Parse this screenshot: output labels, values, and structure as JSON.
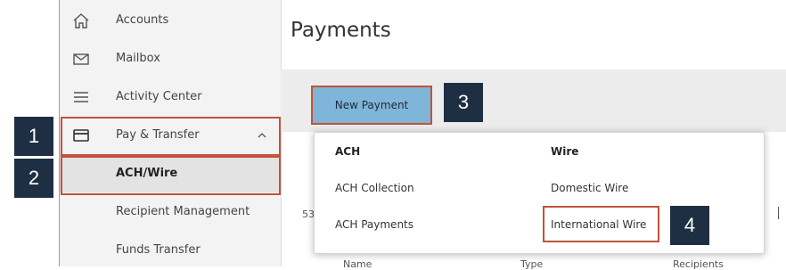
{
  "sidebar": {
    "items": [
      {
        "label": "Accounts",
        "icon": "home-icon"
      },
      {
        "label": "Mailbox",
        "icon": "mail-icon"
      },
      {
        "label": "Activity Center",
        "icon": "list-icon"
      },
      {
        "label": "Pay & Transfer",
        "icon": "card-icon"
      },
      {
        "label": "ACH/Wire"
      },
      {
        "label": "Recipient Management"
      },
      {
        "label": "Funds Transfer"
      }
    ]
  },
  "main": {
    "title": "Payments",
    "new_payment_label": "New Payment",
    "partial_left_number": "53",
    "menu": {
      "col1_header": "ACH",
      "col1_items": [
        "ACH Collection",
        "ACH Payments"
      ],
      "col2_header": "Wire",
      "col2_items": [
        "Domestic Wire",
        "International Wire"
      ]
    },
    "table_headers": [
      "Name",
      "Type",
      "Recipients"
    ]
  },
  "callouts": [
    "1",
    "2",
    "3",
    "4"
  ],
  "colors": {
    "highlight": "#c0533a",
    "callout_bg": "#1f2f43",
    "button_bg": "#7fb5d8"
  }
}
